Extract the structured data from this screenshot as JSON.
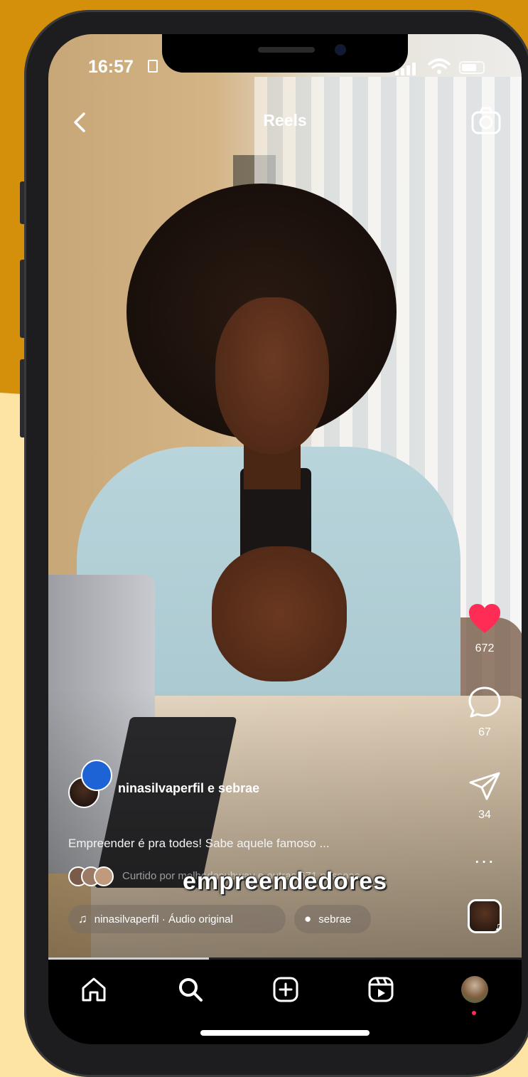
{
  "status_bar": {
    "time": "16:57"
  },
  "header": {
    "title": "Reels"
  },
  "actions": {
    "likes": "672",
    "comments": "67",
    "shares": "34",
    "more": "..."
  },
  "post": {
    "username": "ninasilvaperfil e sebrae",
    "caption": "Empreender é pra todes! Sabe aquele famoso ...",
    "liked_by": "Curtido por melhodosubway e outras 671 pessoas",
    "subtitle": "empreendedores",
    "audio": "ninasilvaperfil · Áudio original",
    "tagged_user": "sebrae"
  },
  "colors": {
    "background_top": "#d4900a",
    "background_bottom": "#fde4a5",
    "like_red": "#ff2d55",
    "phone_frame": "#1d1d1f"
  },
  "progress": 0.34,
  "icons": [
    "back-icon",
    "camera-icon",
    "heart-icon",
    "comment-icon",
    "share-icon",
    "more-icon",
    "music-icon",
    "person-icon",
    "home-icon",
    "search-icon",
    "create-icon",
    "reels-icon"
  ]
}
